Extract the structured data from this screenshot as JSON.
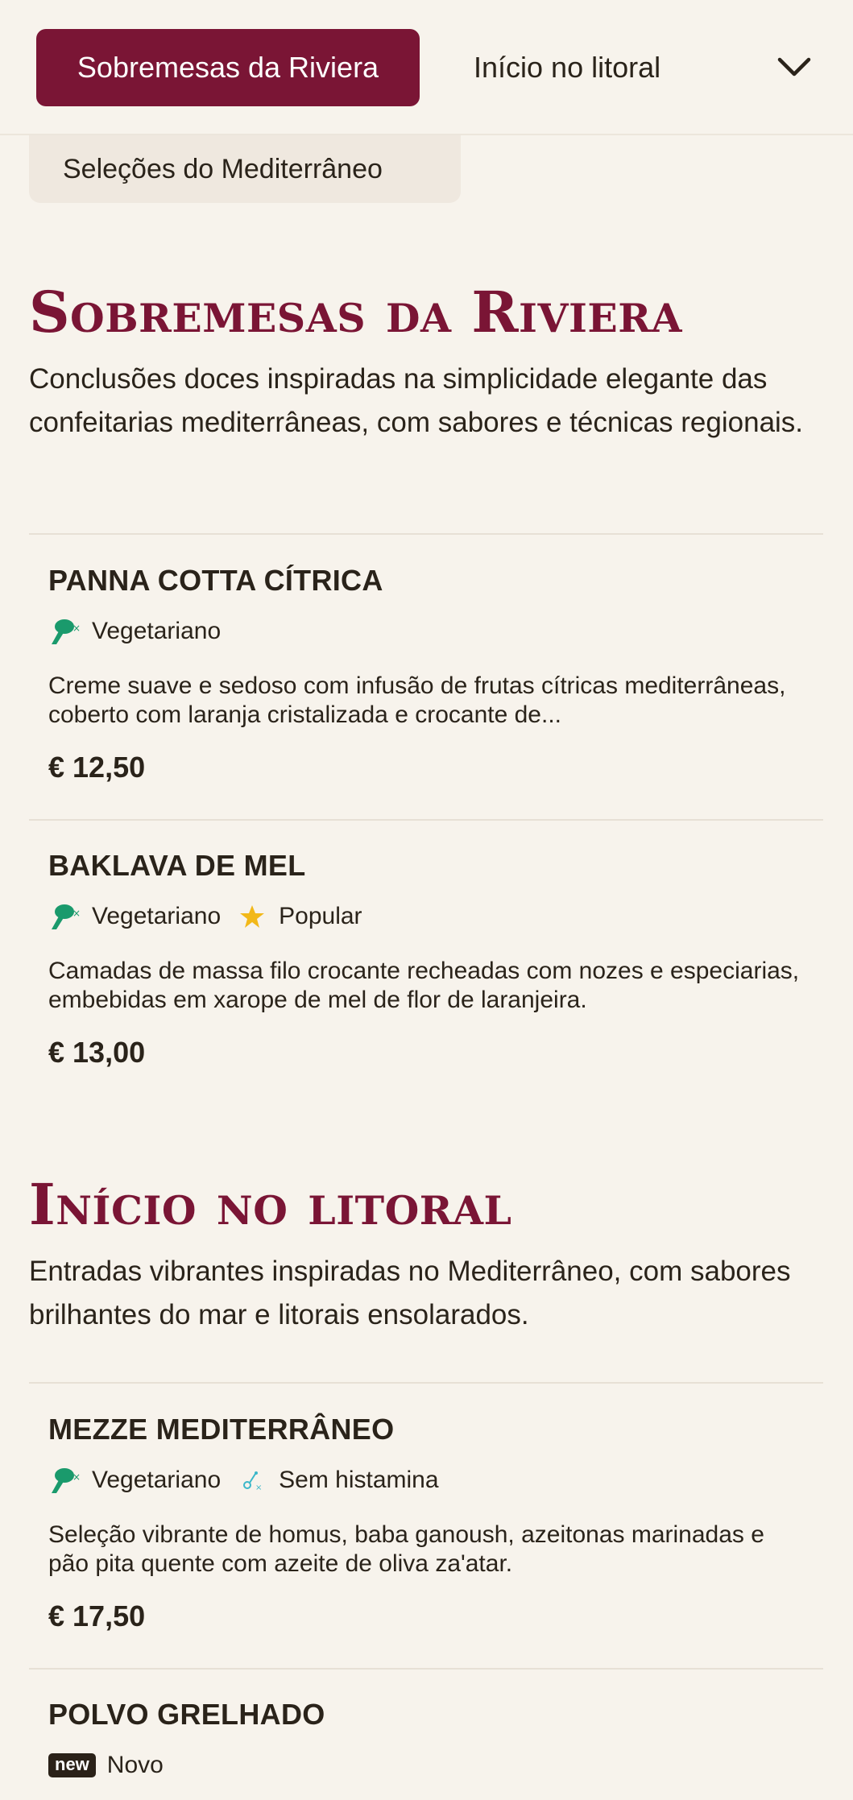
{
  "nav": {
    "tabs": [
      "Sobremesas da Riviera",
      "Início no litoral"
    ],
    "active_tab": "Sobremesas da Riviera",
    "dropdown_item": "Seleções do Mediterrâneo",
    "chevron_icon": "chevron-down-icon"
  },
  "sections": [
    {
      "title": "Sobremesas da Riviera",
      "description": "Conclusões doces inspiradas na simplicidade elegante das confeitarias mediterrâneas, com sabores e técnicas regionais.",
      "items": [
        {
          "name": "PANNA COTTA CÍTRICA",
          "tags": [
            {
              "icon": "vegetarian-icon",
              "label": "Vegetariano"
            }
          ],
          "description": "Creme suave e sedoso com infusão de frutas cítricas mediterrâneas, coberto com laranja cristalizada e crocante de...",
          "price": "€ 12,50"
        },
        {
          "name": "BAKLAVA DE MEL",
          "tags": [
            {
              "icon": "vegetarian-icon",
              "label": "Vegetariano"
            },
            {
              "icon": "star-icon",
              "label": "Popular"
            }
          ],
          "description": "Camadas de massa filo crocante recheadas com nozes e especiarias, embebidas em xarope de mel de flor de laranjeira.",
          "price": "€ 13,00"
        }
      ]
    },
    {
      "title": "Início no litoral",
      "description": "Entradas vibrantes inspiradas no Mediterrâneo, com sabores brilhantes do mar e litorais ensolarados.",
      "items": [
        {
          "name": "MEZZE MEDITERRÂNEO",
          "tags": [
            {
              "icon": "vegetarian-icon",
              "label": "Vegetariano"
            },
            {
              "icon": "histamine-free-icon",
              "label": "Sem histamina"
            }
          ],
          "description": "Seleção vibrante de homus, baba ganoush, azeitonas marinadas e pão pita quente com azeite de oliva za'atar.",
          "price": "€ 17,50"
        },
        {
          "name": "POLVO GRELHADO",
          "tags": [
            {
              "icon": "new-badge-icon",
              "badge": "new",
              "label": "Novo"
            }
          ]
        }
      ]
    }
  ],
  "colors": {
    "accent": "#7a1535",
    "background": "#f7f3ec",
    "vegetarian": "#1a9a6c",
    "star": "#f2b819",
    "histamine": "#3bb7c9"
  }
}
